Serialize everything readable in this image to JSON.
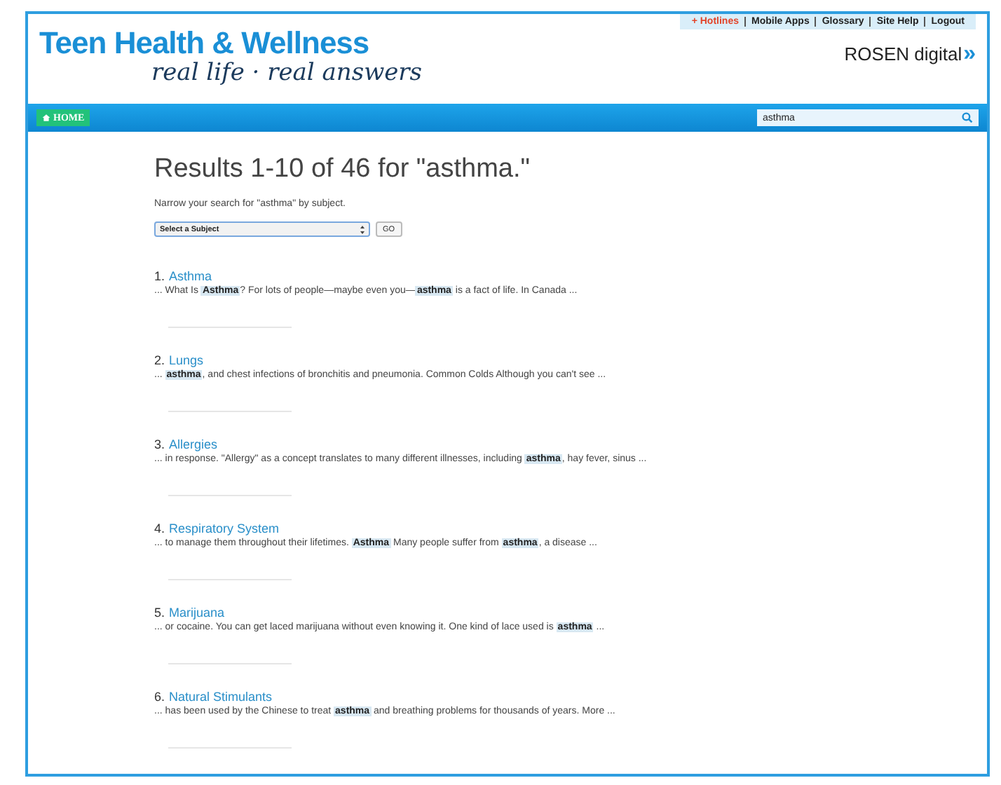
{
  "header": {
    "title": "Teen Health & Wellness",
    "tagline": "real life · real answers",
    "brand": "ROSEN digital",
    "brand_mark": "»",
    "top_links": [
      {
        "label": "+ Hotlines",
        "kind": "alert"
      },
      {
        "label": "Mobile Apps",
        "kind": "plain"
      },
      {
        "label": "Glossary",
        "kind": "plain"
      },
      {
        "label": "Site Help",
        "kind": "plain"
      },
      {
        "label": "Logout",
        "kind": "plain"
      }
    ]
  },
  "nav": {
    "home": "HOME",
    "search": {
      "value": "asthma"
    }
  },
  "results": {
    "heading": "Results 1-10 of 46 for \"asthma.\"",
    "narrow": "Narrow your search for \"asthma\" by subject.",
    "subject_select": "Select a Subject",
    "go": "GO",
    "items": [
      {
        "number": "1.",
        "title": "Asthma",
        "snippet": "... What Is **Asthma**? For lots of people—maybe even you—**asthma** is a fact of life. In Canada ..."
      },
      {
        "number": "2.",
        "title": "Lungs",
        "snippet": "... **asthma**, and chest infections of bronchitis and pneumonia. Common Colds Although you can't see ..."
      },
      {
        "number": "3.",
        "title": "Allergies",
        "snippet": "... in response. \"Allergy\" as a concept translates to many different illnesses, including **asthma**, hay fever, sinus ..."
      },
      {
        "number": "4.",
        "title": "Respiratory System",
        "snippet": "... to manage them throughout their lifetimes. **Asthma** Many people suffer from **asthma**, a disease ..."
      },
      {
        "number": "5.",
        "title": "Marijuana",
        "snippet": "... or cocaine. You can get laced marijuana without even knowing it. One kind of lace used is **asthma** ..."
      },
      {
        "number": "6.",
        "title": "Natural Stimulants",
        "snippet": "... has been used by the Chinese to treat **asthma** and breathing problems for thousands of years. More ..."
      }
    ]
  }
}
